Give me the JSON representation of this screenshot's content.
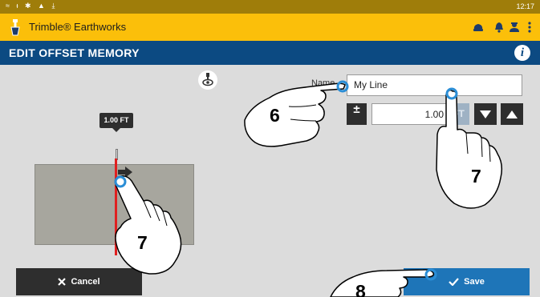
{
  "status_bar": {
    "icons": [
      "wifi-icon",
      "antenna-icon",
      "gps-icon",
      "warning-icon",
      "download-icon"
    ],
    "time": "12:17"
  },
  "app_bar": {
    "title": "Trimble® Earthworks",
    "icons": [
      "machine-icon",
      "bell-icon",
      "operator-icon",
      "overflow-menu-icon"
    ]
  },
  "title_bar": {
    "title": "EDIT OFFSET MEMORY",
    "info_label": "i"
  },
  "form": {
    "name_label": "Name",
    "name_value": "My Line",
    "plusminus_label": "±",
    "offset_value": "1.00",
    "unit": "FT"
  },
  "view": {
    "offset_tag": "1.00 FT"
  },
  "footer": {
    "cancel_label": "Cancel",
    "save_label": "Save"
  },
  "annotations": {
    "step_6": "6",
    "step_7_view": "7",
    "step_7_unit": "7",
    "step_8": "8"
  },
  "colors": {
    "status_bar": "#9f7d0a",
    "app_bar": "#fbbf0a",
    "title_bar": "#0c4a82",
    "save_button": "#1e75b8",
    "dark_button": "#2e2e2e",
    "offset_line": "#e02020",
    "touch_marker": "#2b8ed6"
  }
}
